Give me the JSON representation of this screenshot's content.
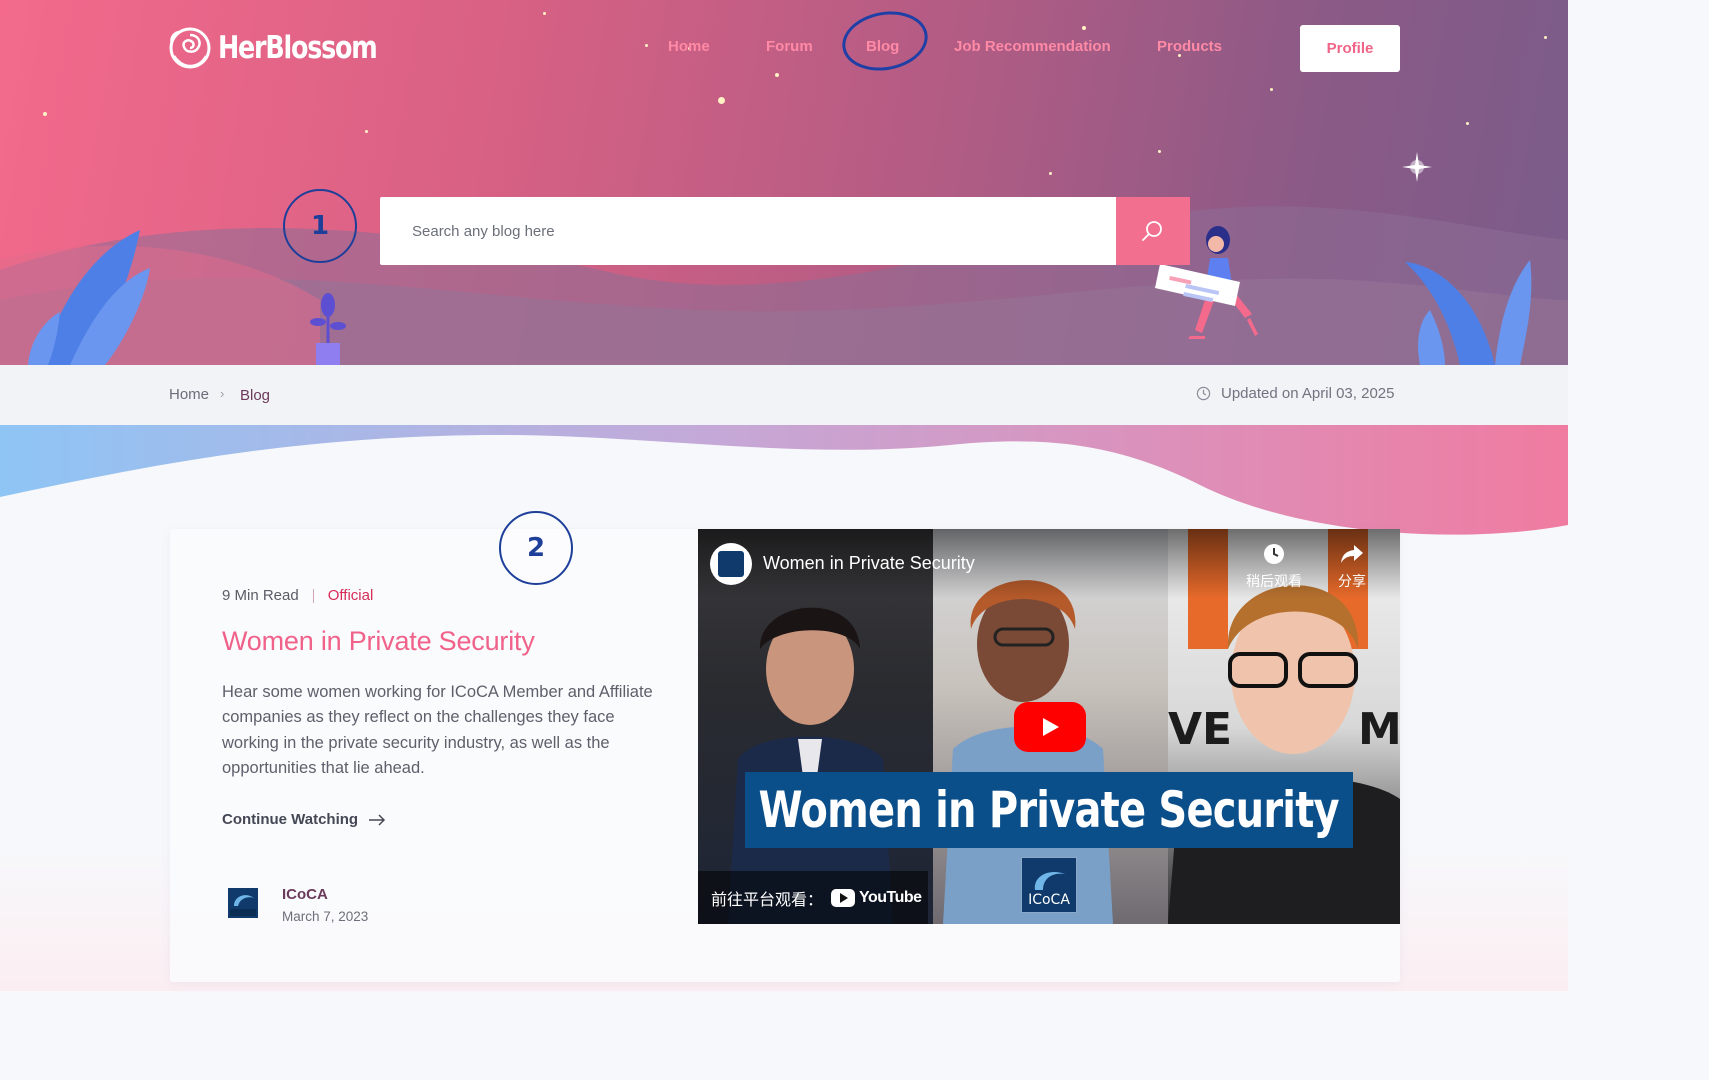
{
  "brand": {
    "name": "HerBlossom"
  },
  "nav": {
    "items": [
      {
        "label": "Home"
      },
      {
        "label": "Forum"
      },
      {
        "label": "Blog"
      },
      {
        "label": "Job Recommendation"
      },
      {
        "label": "Products"
      }
    ],
    "profile_label": "Profile"
  },
  "search": {
    "placeholder": "Search any blog here"
  },
  "annotations": [
    "1",
    "2"
  ],
  "breadcrumb": {
    "home": "Home",
    "separator": "›",
    "current": "Blog"
  },
  "updated": "Updated on April 03, 2025",
  "post": {
    "read_time": "9 Min Read",
    "tag": "Official",
    "title": "Women in Private Security",
    "description": "Hear some women working for ICoCA Member and Affiliate companies as they reflect on the challenges they face working in the private security industry, as well as the opportunities that lie ahead.",
    "cta": "Continue Watching",
    "author": {
      "name": "ICoCA",
      "date": "March 7, 2023",
      "logo_text": "ICoCA"
    }
  },
  "video": {
    "title": "Women in Private Security",
    "watch_later": "稍后观看",
    "share": "分享",
    "banner": "Women in Private Security",
    "watch_on": "前往平台观看：",
    "platform": "YouTube",
    "badge": "ICoCA"
  },
  "colors": {
    "accent": "#f0628a",
    "hero_start": "#f36a8c",
    "hero_end": "#7a5c8a",
    "annotation": "#1e3f99"
  },
  "icons": [
    "rose-logo-icon",
    "search-icon",
    "chevron-right-icon",
    "clock-icon",
    "arrow-right-icon",
    "play-icon",
    "clock-icon",
    "share-icon",
    "youtube-icon"
  ]
}
